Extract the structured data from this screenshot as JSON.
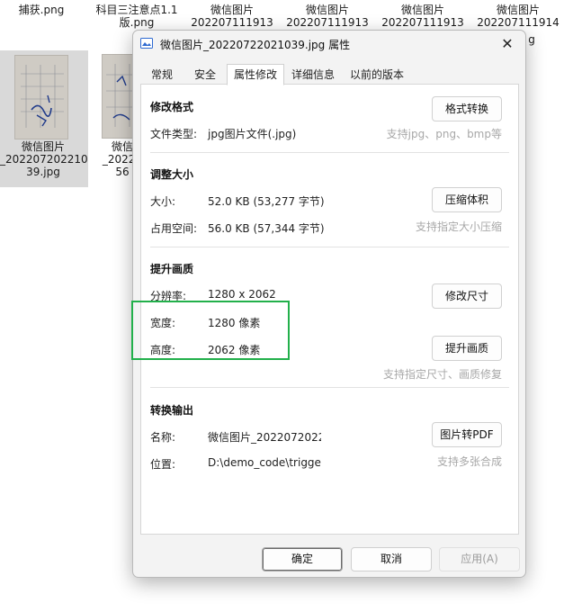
{
  "desktop": {
    "files": [
      {
        "label": "捕获.png"
      },
      {
        "label": "科目三注意点1.1\n版.png"
      },
      {
        "label": "微信图片\n202207111913"
      },
      {
        "label": "微信图片\n202207111913"
      },
      {
        "label": "微信图片\n202207111913"
      },
      {
        "label": "微信图片\n202207111914"
      },
      {
        "label": "微信图片\n_202207202210\n39.jpg"
      },
      {
        "label": "微信\n_20220\n56"
      }
    ],
    "peek_text": "g"
  },
  "dialog": {
    "title": "微信图片_20220722021039.jpg 属性",
    "close_glyph": "✕",
    "tabs": [
      "常规",
      "安全",
      "属性修改",
      "详细信息",
      "以前的版本"
    ],
    "active_tab": "属性修改",
    "sections": {
      "format": {
        "title": "修改格式",
        "type_label": "文件类型:",
        "type_value": "jpg图片文件(.jpg)",
        "button": "格式转换",
        "hint": "支持jpg、png、bmp等"
      },
      "resize": {
        "title": "调整大小",
        "size_label": "大小:",
        "size_value": "52.0 KB (53,277 字节)",
        "disk_label": "占用空间:",
        "disk_value": "56.0 KB (57,344 字节)",
        "button": "压缩体积",
        "hint": "支持指定大小压缩"
      },
      "quality": {
        "title": "提升画质",
        "res_label": "分辨率:",
        "res_value": "1280 x 2062",
        "res_button": "修改尺寸",
        "width_label": "宽度:",
        "width_value": "1280 像素",
        "height_label": "高度:",
        "height_value": "2062 像素",
        "enhance_button": "提升画质",
        "hint": "支持指定尺寸、画质修复"
      },
      "export": {
        "title": "转换输出",
        "name_label": "名称:",
        "name_value": "微信图片_2022072022",
        "location_label": "位置:",
        "location_value": "D:\\demo_code\\trigge",
        "button": "图片转PDF",
        "hint": "支持多张合成"
      }
    },
    "footer": {
      "ok": "确定",
      "cancel": "取消",
      "apply": "应用(A)"
    }
  },
  "colors": {
    "highlight_box": "#22b04b",
    "dialog_bg": "#f3f3f3",
    "hint_text": "#a8a8a8"
  }
}
